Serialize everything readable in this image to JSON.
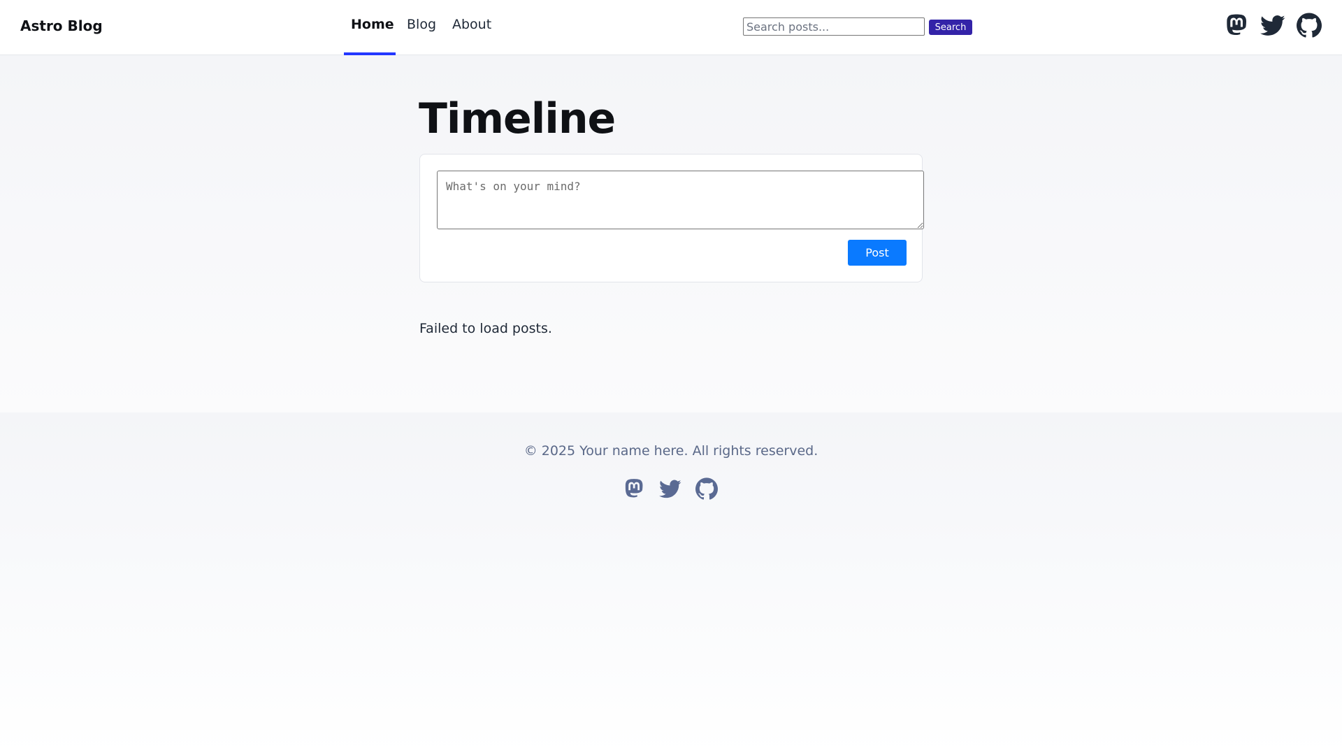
{
  "header": {
    "logo": "Astro Blog",
    "nav": [
      {
        "label": "Home",
        "active": true
      },
      {
        "label": "Blog",
        "active": false
      },
      {
        "label": "About",
        "active": false
      }
    ],
    "search": {
      "placeholder": "Search posts...",
      "value": "",
      "button_label": "Search"
    },
    "social_icons": [
      "mastodon-icon",
      "twitter-icon",
      "github-icon"
    ],
    "accent_color": "#2337ff"
  },
  "main": {
    "title": "Timeline",
    "composer": {
      "placeholder": "What's on your mind?",
      "value": "",
      "post_label": "Post",
      "post_color": "#0a7aff"
    },
    "status_message": "Failed to load posts."
  },
  "footer": {
    "copyright": "© 2025 Your name here. All rights reserved.",
    "social_icons": [
      "mastodon-icon",
      "twitter-icon",
      "github-icon"
    ]
  }
}
